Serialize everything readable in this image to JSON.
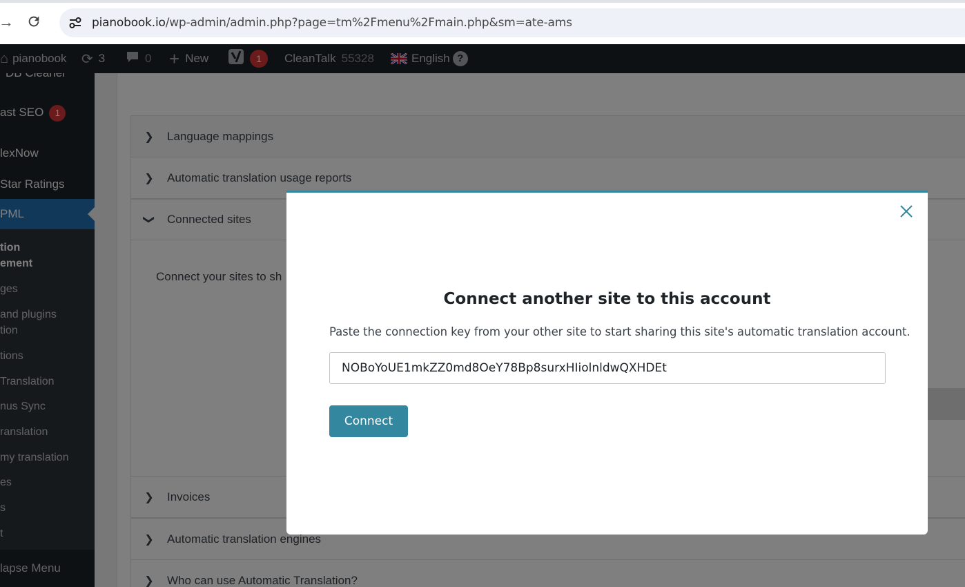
{
  "browser": {
    "url_host": "pianobook.io",
    "url_path": "/wp-admin/admin.php?page=tm%2Fmenu%2Fmain.php&sm=ate-ams"
  },
  "adminbar": {
    "site_name": "pianobook",
    "updates_count": "3",
    "comments_count": "0",
    "new_label": "New",
    "yoast_count": "1",
    "cleantalk_label": "CleanTalk",
    "cleantalk_count": "55328",
    "language_label": "English",
    "help_label": "?"
  },
  "sidebar": {
    "items": [
      {
        "label": "DB Cleaner"
      },
      {
        "label": "ast SEO",
        "badge": "1"
      },
      {
        "label": "lexNow"
      },
      {
        "label": "Star Ratings"
      },
      {
        "label": "PML"
      }
    ],
    "submenu": [
      {
        "label": "tion"
      },
      {
        "label": "ement"
      },
      {
        "label": "ges"
      },
      {
        "label": "and plugins"
      },
      {
        "label": "tion"
      },
      {
        "label": "tions"
      },
      {
        "label": "Translation"
      },
      {
        "label": "nus Sync"
      },
      {
        "label": "ranslation"
      },
      {
        "label": "my translation"
      },
      {
        "label": "es"
      },
      {
        "label": "s"
      },
      {
        "label": "t"
      }
    ],
    "collapse_label": "lapse Menu"
  },
  "sections": [
    {
      "title": "Language mappings"
    },
    {
      "title": "Automatic translation usage reports"
    },
    {
      "title": "Connected sites"
    },
    {
      "title": "Invoices"
    },
    {
      "title": "Automatic translation engines"
    },
    {
      "title": "Who can use Automatic Translation?"
    }
  ],
  "connected_sites_text": "Connect your sites to sh",
  "modal": {
    "title": "Connect another site to this account",
    "description": "Paste the connection key from your other site to start sharing this site's automatic translation account.",
    "key_value": "NOBoYoUE1mkZZ0md8OeY78Bp8surxHIiolnldwQXHDEt",
    "connect_label": "Connect"
  },
  "colors": {
    "accent": "#33879e",
    "admin_bar": "#1d2327",
    "active_menu": "#2271b1",
    "badge": "#d63638"
  }
}
